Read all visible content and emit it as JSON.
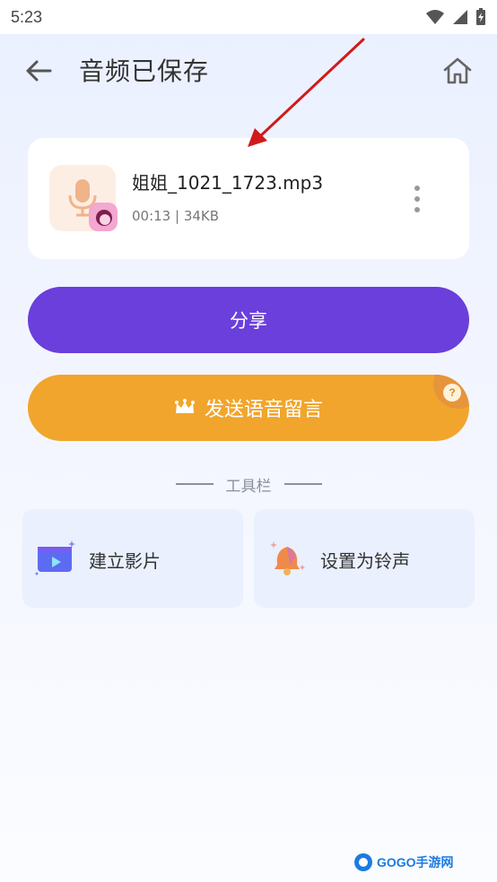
{
  "status_bar": {
    "time": "5:23"
  },
  "app_bar": {
    "title": "音频已保存"
  },
  "file": {
    "name": "姐姐_1021_1723.mp3",
    "meta": "00:13 | 34KB"
  },
  "buttons": {
    "share": "分享",
    "voicemail": "发送语音留言",
    "help_mark": "?"
  },
  "toolbar": {
    "label": "工具栏",
    "items": [
      {
        "label": "建立影片",
        "icon": "movie-icon"
      },
      {
        "label": "设置为铃声",
        "icon": "bell-icon"
      }
    ]
  },
  "watermark": {
    "text": "GOGO手游网"
  },
  "colors": {
    "share": "#6a3fdb",
    "voicemail": "#f1a52c",
    "annotation_arrow": "#d11a1a"
  }
}
